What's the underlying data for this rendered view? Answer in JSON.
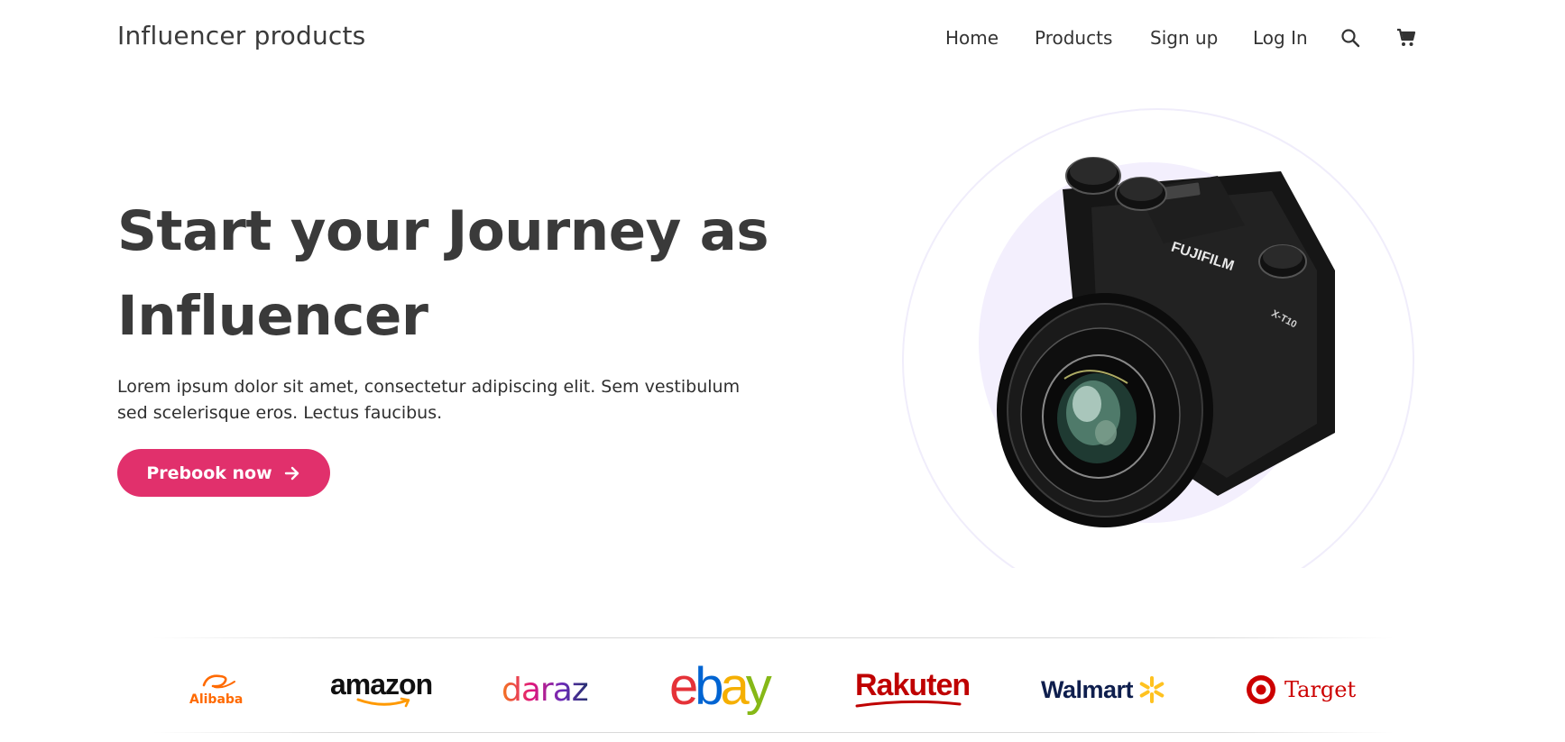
{
  "header": {
    "brand": "Influencer products",
    "nav": {
      "home": "Home",
      "products": "Products",
      "signup": "Sign up",
      "login": "Log In"
    },
    "icons": [
      "search-icon",
      "cart-icon"
    ]
  },
  "hero": {
    "title_line1": "Start your Journey as",
    "title_line2": "Influencer",
    "description": "Lorem ipsum dolor sit amet, consectetur adipiscing elit. Sem vestibulum sed scelerisque eros. Lectus faucibus.",
    "cta_label": "Prebook now",
    "cta_icon": "arrow-right-icon",
    "image": {
      "subject": "camera",
      "camera_brand": "FUJIFILM",
      "camera_model": "X-T10"
    }
  },
  "brands": {
    "alibaba": "Alibaba",
    "amazon": "amazon",
    "daraz": "daraz",
    "ebay": "ebay",
    "rakuten": "Rakuten",
    "walmart": "Walmart",
    "target": "Target"
  },
  "colors": {
    "accent": "#e1306c",
    "text": "#3a3a3a",
    "blob": "#f3effd"
  }
}
